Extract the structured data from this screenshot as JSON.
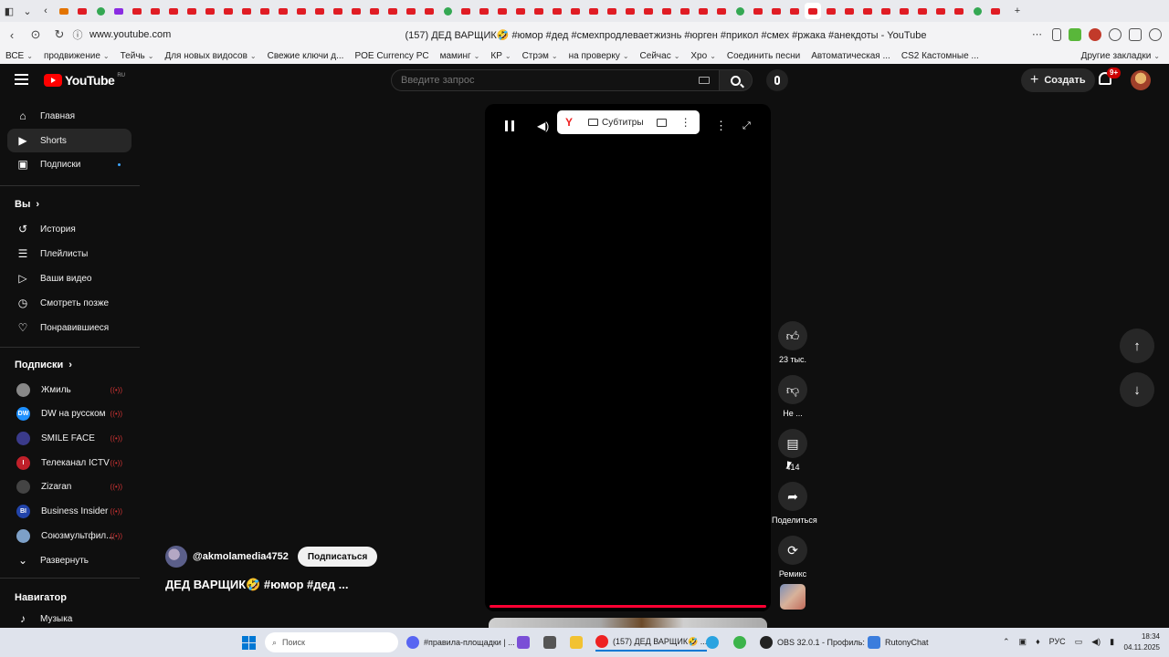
{
  "browser": {
    "url": "www.youtube.com",
    "page_title": "(157) ДЕД ВАРЩИК🤣 #юмор #дед #смехпродлеваетжизнь #юрген #прикол #смех #ржака #анекдоты - YouTube",
    "bookmarks": [
      {
        "label": "ВСЕ",
        "chevron": true
      },
      {
        "label": "продвижение",
        "chevron": true
      },
      {
        "label": "Тейчь",
        "chevron": true
      },
      {
        "label": "Для новых видосов",
        "chevron": true
      },
      {
        "label": "Свежие ключи д...",
        "chevron": false
      },
      {
        "label": "POE Currency PC",
        "chevron": false
      },
      {
        "label": "маминг",
        "chevron": true
      },
      {
        "label": "КР",
        "chevron": true
      },
      {
        "label": "Стрэм",
        "chevron": true
      },
      {
        "label": "на проверку",
        "chevron": true
      },
      {
        "label": "Сейчас",
        "chevron": true
      },
      {
        "label": "Хро",
        "chevron": true
      },
      {
        "label": "Соединить песни",
        "chevron": false
      },
      {
        "label": "Автоматическая ...",
        "chevron": false
      },
      {
        "label": "CS2 Кастомные ...",
        "chevron": false
      }
    ],
    "other_bookmarks": "Другие закладки"
  },
  "header": {
    "logo_text": "YouTube",
    "region": "RU",
    "search_placeholder": "Введите запрос",
    "create_label": "Создать",
    "notification_count": "9+"
  },
  "sidebar": {
    "main": [
      {
        "label": "Главная",
        "icon": "home-icon"
      },
      {
        "label": "Shorts",
        "icon": "shorts-icon"
      },
      {
        "label": "Подписки",
        "icon": "subscriptions-icon"
      }
    ],
    "you_title": "Вы",
    "you_items": [
      {
        "label": "История",
        "icon": "history-icon"
      },
      {
        "label": "Плейлисты",
        "icon": "playlists-icon"
      },
      {
        "label": "Ваши видео",
        "icon": "your-videos-icon"
      },
      {
        "label": "Смотреть позже",
        "icon": "watch-later-icon"
      },
      {
        "label": "Понравившиеся",
        "icon": "liked-icon"
      }
    ],
    "subs_title": "Подписки",
    "subs": [
      {
        "label": "Жмиль"
      },
      {
        "label": "DW на русском"
      },
      {
        "label": "SMILE FACE"
      },
      {
        "label": "Телеканал ICTV"
      },
      {
        "label": "Zizaran"
      },
      {
        "label": "Business Insider"
      },
      {
        "label": "Союзмультфил..."
      }
    ],
    "expand_label": "Развернуть",
    "navigator_title": "Навигатор",
    "music_label": "Музыка",
    "live_glyph": "((•))"
  },
  "player": {
    "subtitles_label": "Субтитры",
    "channel": "@akmolamedia4752",
    "subscribe_label": "Подписаться",
    "title": "ДЕД ВАРЩИК🤣 #юмор #дед ...",
    "progress": 1.0
  },
  "actions": {
    "likes": "23 тыс.",
    "dislike": "Не ...",
    "comments": "414",
    "share": "Поделиться",
    "remix": "Ремикс"
  },
  "taskbar": {
    "search_placeholder": "Поиск",
    "apps": [
      {
        "label": "#правила-площадки | ..."
      },
      {
        "label": "(157) ДЕД ВАРЩИК🤣 ..."
      },
      {
        "label": "OBS 32.0.1 - Профиль: ..."
      },
      {
        "label": "RutonyChat"
      }
    ],
    "language": "РУС",
    "time": "18:34",
    "date": "04.11.2025"
  },
  "colors": {
    "background": "#0f0f0f",
    "accent_red": "#ff0033",
    "surface": "#272727"
  }
}
